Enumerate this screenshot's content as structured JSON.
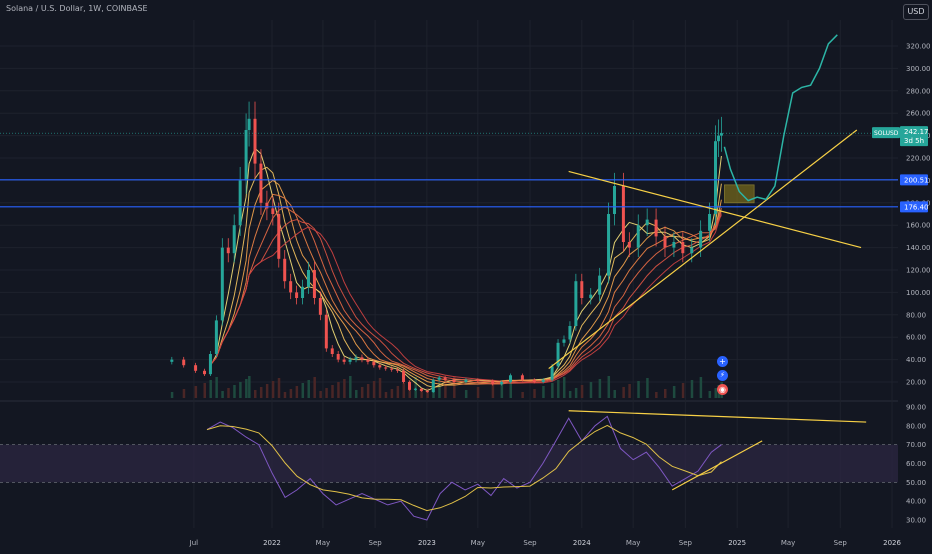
{
  "header": {
    "symbol_title": "Solana / U.S. Dollar, 1W, COINBASE",
    "currency": "USD"
  },
  "side_buttons": {
    "plus": "+",
    "flash": "⚡",
    "alert": "◉"
  },
  "price_labels": {
    "symbol": "SOLUSD",
    "price": "242.17",
    "countdown": "3d 5h",
    "level_upper": "200.51",
    "level_lower": "176.40"
  },
  "colors": {
    "background": "#131722",
    "up": "#26a69a",
    "down": "#ef5350",
    "level_line": "#2962ff",
    "trendline": "#f7d046",
    "projection": "#2cb5a6",
    "rsi_line": "#7e57c2",
    "rsi_band": "#2a2540"
  },
  "chart_data": [
    {
      "type": "line",
      "title": "",
      "x_tick_labels": [
        "Jul",
        "2022",
        "May",
        "Sep",
        "2023",
        "May",
        "Sep",
        "2024",
        "May",
        "Sep",
        "2025",
        "May",
        "Sep",
        "2026"
      ],
      "y_tick_labels": [
        "320.00",
        "300.00",
        "280.00",
        "260.00",
        "240.00",
        "220.00",
        "200.00",
        "180.00",
        "160.00",
        "140.00",
        "120.00",
        "100.00",
        "80.00",
        "60.00",
        "40.00",
        "20.00"
      ],
      "ylim": [
        10,
        335
      ],
      "series": [
        {
          "x": [
            "2021-05-10",
            "2021-06-07",
            "2021-07-05",
            "2021-07-26",
            "2021-08-09",
            "2021-08-23",
            "2021-09-06",
            "2021-09-20",
            "2021-10-04",
            "2021-10-18",
            "2021-11-01",
            "2021-11-08",
            "2021-11-22",
            "2021-12-06",
            "2021-12-20",
            "2022-01-03",
            "2022-01-17",
            "2022-01-31",
            "2022-02-14",
            "2022-02-28",
            "2022-03-14",
            "2022-03-28",
            "2022-04-11",
            "2022-04-25",
            "2022-05-09",
            "2022-05-23",
            "2022-06-06",
            "2022-06-20",
            "2022-07-04",
            "2022-07-18",
            "2022-08-01",
            "2022-08-15",
            "2022-08-29",
            "2022-09-12",
            "2022-09-26",
            "2022-10-10",
            "2022-10-24",
            "2022-11-07",
            "2022-11-21",
            "2022-12-05",
            "2022-12-19",
            "2023-01-02",
            "2023-01-16",
            "2023-01-30",
            "2023-02-13",
            "2023-03-06",
            "2023-04-03",
            "2023-05-01",
            "2023-06-05",
            "2023-06-26",
            "2023-07-17",
            "2023-08-14",
            "2023-09-11",
            "2023-10-02",
            "2023-10-23",
            "2023-11-06",
            "2023-11-20",
            "2023-12-04",
            "2023-12-18",
            "2024-01-01",
            "2024-01-22",
            "2024-02-12",
            "2024-03-04",
            "2024-03-18",
            "2024-04-08",
            "2024-04-22",
            "2024-05-13",
            "2024-06-03",
            "2024-06-24",
            "2024-07-15",
            "2024-08-05",
            "2024-08-26",
            "2024-09-16",
            "2024-10-07",
            "2024-10-28",
            "2024-11-11",
            "2024-11-18",
            "2024-11-25"
          ],
          "values": [
            40,
            35,
            30,
            27,
            45,
            75,
            140,
            135,
            160,
            200,
            245,
            255,
            215,
            180,
            175,
            170,
            130,
            110,
            100,
            95,
            105,
            120,
            95,
            80,
            50,
            45,
            40,
            38,
            40,
            42,
            40,
            38,
            35,
            33,
            32,
            31,
            30,
            20,
            13,
            14,
            12,
            11,
            22,
            24,
            22,
            20,
            22,
            21,
            18,
            20,
            26,
            22,
            20,
            22,
            34,
            55,
            58,
            70,
            110,
            95,
            98,
            115,
            170,
            195,
            145,
            140,
            160,
            165,
            150,
            140,
            145,
            135,
            140,
            155,
            170,
            235,
            240,
            242.17
          ],
          "name": ""
        }
      ],
      "horizontal_levels": [
        200.51,
        176.4
      ],
      "projection": {
        "x": [
          "2024-12-02",
          "2024-12-16",
          "2025-01-06",
          "2025-01-27",
          "2025-02-17",
          "2025-03-10",
          "2025-03-31",
          "2025-04-21",
          "2025-05-12",
          "2025-06-02",
          "2025-06-23",
          "2025-07-14",
          "2025-08-04",
          "2025-08-25"
        ],
        "values": [
          230,
          210,
          190,
          182,
          185,
          183,
          195,
          240,
          278,
          283,
          285,
          300,
          322,
          330
        ]
      },
      "target_box": {
        "x": [
          "2024-12-02",
          "2025-02-10"
        ],
        "y": [
          180,
          196
        ]
      },
      "grid": true
    },
    {
      "type": "line",
      "title": "",
      "y_tick_labels": [
        "90.00",
        "80.00",
        "70.00",
        "60.00",
        "50.00",
        "40.00",
        "30.00"
      ],
      "ylim": [
        28,
        92
      ],
      "band": [
        50,
        70
      ],
      "series": [
        {
          "name": "",
          "x": [
            "2021-08-01",
            "2021-09-01",
            "2021-10-01",
            "2021-11-01",
            "2021-12-01",
            "2022-01-01",
            "2022-02-01",
            "2022-03-01",
            "2022-04-01",
            "2022-05-01",
            "2022-06-01",
            "2022-07-01",
            "2022-08-01",
            "2022-09-01",
            "2022-10-01",
            "2022-11-01",
            "2022-12-01",
            "2023-01-01",
            "2023-02-01",
            "2023-03-01",
            "2023-04-01",
            "2023-05-01",
            "2023-06-01",
            "2023-07-01",
            "2023-08-01",
            "2023-09-01",
            "2023-10-01",
            "2023-11-01",
            "2023-12-01",
            "2024-01-01",
            "2024-02-01",
            "2024-03-01",
            "2024-04-01",
            "2024-05-01",
            "2024-06-01",
            "2024-07-01",
            "2024-08-01",
            "2024-09-01",
            "2024-10-01",
            "2024-11-01",
            "2024-11-25"
          ],
          "values": [
            78,
            82,
            79,
            74,
            70,
            55,
            42,
            46,
            52,
            44,
            38,
            41,
            44,
            41,
            38,
            40,
            32,
            30,
            44,
            50,
            46,
            49,
            43,
            52,
            47,
            50,
            60,
            72,
            84,
            72,
            80,
            85,
            68,
            62,
            66,
            58,
            48,
            52,
            56,
            66,
            70
          ]
        }
      ],
      "trendlines": [
        {
          "x": [
            "2023-12-01",
            "2025-11-01"
          ],
          "values": [
            88,
            82
          ]
        },
        {
          "x": [
            "2024-08-01",
            "2025-03-01"
          ],
          "values": [
            46,
            72
          ]
        }
      ]
    }
  ]
}
